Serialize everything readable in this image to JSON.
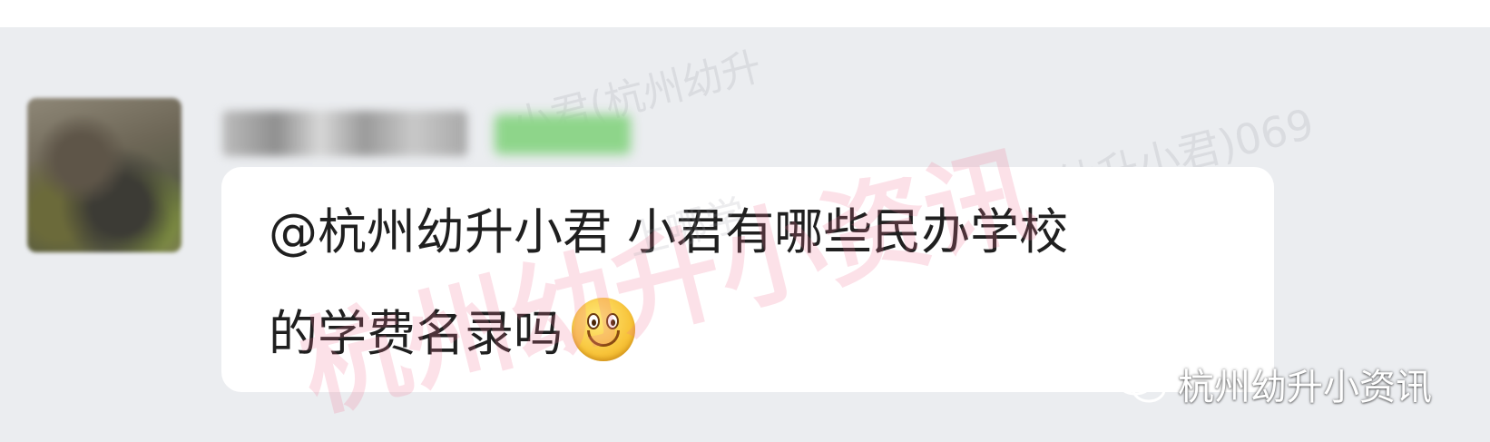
{
  "message": {
    "line1": "@杭州幼升小君 小君有哪些民办学校",
    "line2": "的学费名录吗",
    "emoji_icon": "smiley-emoji-icon"
  },
  "watermarks": {
    "main": "杭州幼升小资讯",
    "small1": "小君(杭州幼升",
    "small2": "州幼升小君)069",
    "small3": "上哪学"
  },
  "brand": {
    "label": "杭州幼升小资讯",
    "icon": "wechat-icon"
  },
  "colors": {
    "chat_background": "#ebedf0",
    "bubble": "#ffffff",
    "watermark": "#f07896"
  }
}
